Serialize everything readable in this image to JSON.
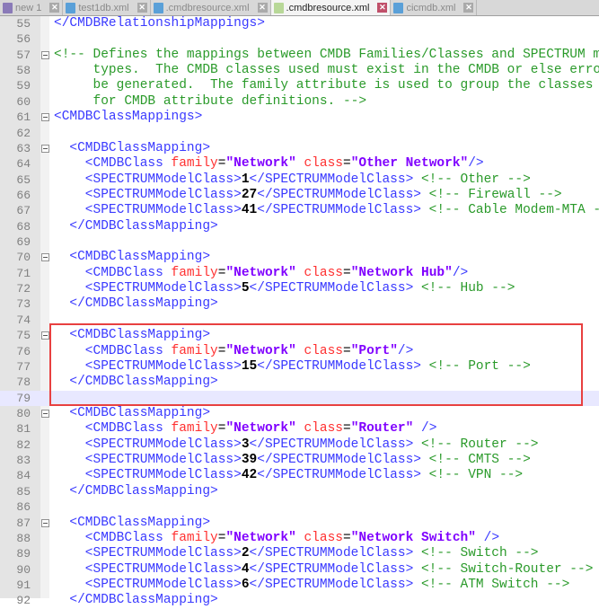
{
  "tabs": [
    {
      "label": "new 1",
      "active": false
    },
    {
      "label": "test1db.xml",
      "active": false
    },
    {
      "label": ".cmdbresource.xml",
      "active": false
    },
    {
      "label": ".cmdbresource.xml",
      "active": true
    },
    {
      "label": "cicmdb.xml",
      "active": false
    }
  ],
  "close_glyph": "✕",
  "current_line": 79,
  "fold_lines": [
    57,
    61,
    63,
    70,
    75,
    80,
    87
  ],
  "lines": [
    {
      "n": 55,
      "tk": [
        [
          "t",
          "</CMDBRelationshipMappings>"
        ]
      ]
    },
    {
      "n": 56,
      "tk": []
    },
    {
      "n": 57,
      "tk": [
        [
          "c",
          "<!-- Defines the mappings between CMDB Families/Classes and SPECTRUM m"
        ]
      ]
    },
    {
      "n": 58,
      "tk": [
        [
          "c",
          "     types.  The CMDB classes used must exist in the CMDB or else erro"
        ]
      ]
    },
    {
      "n": 59,
      "tk": [
        [
          "c",
          "     be generated.  The family attribute is used to group the classes "
        ]
      ]
    },
    {
      "n": 60,
      "tk": [
        [
          "c",
          "     for CMDB attribute definitions. -->"
        ]
      ]
    },
    {
      "n": 61,
      "tk": [
        [
          "t",
          "<CMDBClassMappings>"
        ]
      ]
    },
    {
      "n": 62,
      "tk": []
    },
    {
      "n": 63,
      "tk": [
        [
          "t",
          "  <CMDBClassMapping>"
        ]
      ]
    },
    {
      "n": 64,
      "tk": [
        [
          "t",
          "    <CMDBClass"
        ],
        [
          "a",
          " family"
        ],
        [
          "e",
          "="
        ],
        [
          "v",
          "\"Network\""
        ],
        [
          "a",
          " class"
        ],
        [
          "e",
          "="
        ],
        [
          "v",
          "\"Other Network\""
        ],
        [
          "t",
          "/>"
        ]
      ]
    },
    {
      "n": 65,
      "tk": [
        [
          "t",
          "    <SPECTRUMModelClass>"
        ],
        [
          "n",
          "1"
        ],
        [
          "t",
          "</SPECTRUMModelClass>"
        ],
        [
          "c",
          " <!-- Other -->"
        ]
      ]
    },
    {
      "n": 66,
      "tk": [
        [
          "t",
          "    <SPECTRUMModelClass>"
        ],
        [
          "n",
          "27"
        ],
        [
          "t",
          "</SPECTRUMModelClass>"
        ],
        [
          "c",
          " <!-- Firewall -->"
        ]
      ]
    },
    {
      "n": 67,
      "tk": [
        [
          "t",
          "    <SPECTRUMModelClass>"
        ],
        [
          "n",
          "41"
        ],
        [
          "t",
          "</SPECTRUMModelClass>"
        ],
        [
          "c",
          " <!-- Cable Modem-MTA -"
        ]
      ]
    },
    {
      "n": 68,
      "tk": [
        [
          "t",
          "  </CMDBClassMapping>"
        ]
      ]
    },
    {
      "n": 69,
      "tk": []
    },
    {
      "n": 70,
      "tk": [
        [
          "t",
          "  <CMDBClassMapping>"
        ]
      ]
    },
    {
      "n": 71,
      "tk": [
        [
          "t",
          "    <CMDBClass"
        ],
        [
          "a",
          " family"
        ],
        [
          "e",
          "="
        ],
        [
          "v",
          "\"Network\""
        ],
        [
          "a",
          " class"
        ],
        [
          "e",
          "="
        ],
        [
          "v",
          "\"Network Hub\""
        ],
        [
          "t",
          "/>"
        ]
      ]
    },
    {
      "n": 72,
      "tk": [
        [
          "t",
          "    <SPECTRUMModelClass>"
        ],
        [
          "n",
          "5"
        ],
        [
          "t",
          "</SPECTRUMModelClass>"
        ],
        [
          "c",
          " <!-- Hub -->"
        ]
      ]
    },
    {
      "n": 73,
      "tk": [
        [
          "t",
          "  </CMDBClassMapping>"
        ]
      ]
    },
    {
      "n": 74,
      "tk": []
    },
    {
      "n": 75,
      "tk": [
        [
          "t",
          "  <CMDBClassMapping>"
        ]
      ]
    },
    {
      "n": 76,
      "tk": [
        [
          "t",
          "    <CMDBClass"
        ],
        [
          "a",
          " family"
        ],
        [
          "e",
          "="
        ],
        [
          "v",
          "\"Network\""
        ],
        [
          "a",
          " class"
        ],
        [
          "e",
          "="
        ],
        [
          "v",
          "\"Port\""
        ],
        [
          "t",
          "/>"
        ]
      ]
    },
    {
      "n": 77,
      "tk": [
        [
          "t",
          "    <SPECTRUMModelClass>"
        ],
        [
          "n",
          "15"
        ],
        [
          "t",
          "</SPECTRUMModelClass>"
        ],
        [
          "c",
          " <!-- Port -->"
        ]
      ]
    },
    {
      "n": 78,
      "tk": [
        [
          "t",
          "  </CMDBClassMapping>"
        ]
      ]
    },
    {
      "n": 79,
      "tk": []
    },
    {
      "n": 80,
      "tk": [
        [
          "t",
          "  <CMDBClassMapping>"
        ]
      ]
    },
    {
      "n": 81,
      "tk": [
        [
          "t",
          "    <CMDBClass"
        ],
        [
          "a",
          " family"
        ],
        [
          "e",
          "="
        ],
        [
          "v",
          "\"Network\""
        ],
        [
          "a",
          " class"
        ],
        [
          "e",
          "="
        ],
        [
          "v",
          "\"Router\""
        ],
        [
          "t",
          " />"
        ]
      ]
    },
    {
      "n": 82,
      "tk": [
        [
          "t",
          "    <SPECTRUMModelClass>"
        ],
        [
          "n",
          "3"
        ],
        [
          "t",
          "</SPECTRUMModelClass>"
        ],
        [
          "c",
          " <!-- Router -->"
        ]
      ]
    },
    {
      "n": 83,
      "tk": [
        [
          "t",
          "    <SPECTRUMModelClass>"
        ],
        [
          "n",
          "39"
        ],
        [
          "t",
          "</SPECTRUMModelClass>"
        ],
        [
          "c",
          " <!-- CMTS -->"
        ]
      ]
    },
    {
      "n": 84,
      "tk": [
        [
          "t",
          "    <SPECTRUMModelClass>"
        ],
        [
          "n",
          "42"
        ],
        [
          "t",
          "</SPECTRUMModelClass>"
        ],
        [
          "c",
          " <!-- VPN -->"
        ]
      ]
    },
    {
      "n": 85,
      "tk": [
        [
          "t",
          "  </CMDBClassMapping>"
        ]
      ]
    },
    {
      "n": 86,
      "tk": []
    },
    {
      "n": 87,
      "tk": [
        [
          "t",
          "  <CMDBClassMapping>"
        ]
      ]
    },
    {
      "n": 88,
      "tk": [
        [
          "t",
          "    <CMDBClass"
        ],
        [
          "a",
          " family"
        ],
        [
          "e",
          "="
        ],
        [
          "v",
          "\"Network\""
        ],
        [
          "a",
          " class"
        ],
        [
          "e",
          "="
        ],
        [
          "v",
          "\"Network Switch\""
        ],
        [
          "t",
          " />"
        ]
      ]
    },
    {
      "n": 89,
      "tk": [
        [
          "t",
          "    <SPECTRUMModelClass>"
        ],
        [
          "n",
          "2"
        ],
        [
          "t",
          "</SPECTRUMModelClass>"
        ],
        [
          "c",
          " <!-- Switch -->"
        ]
      ]
    },
    {
      "n": 90,
      "tk": [
        [
          "t",
          "    <SPECTRUMModelClass>"
        ],
        [
          "n",
          "4"
        ],
        [
          "t",
          "</SPECTRUMModelClass>"
        ],
        [
          "c",
          " <!-- Switch-Router -->"
        ]
      ]
    },
    {
      "n": 91,
      "tk": [
        [
          "t",
          "    <SPECTRUMModelClass>"
        ],
        [
          "n",
          "6"
        ],
        [
          "t",
          "</SPECTRUMModelClass>"
        ],
        [
          "c",
          " <!-- ATM Switch -->"
        ]
      ]
    },
    {
      "n": 92,
      "tk": [
        [
          "t",
          "  </CMDBClassMapping>"
        ]
      ]
    }
  ]
}
